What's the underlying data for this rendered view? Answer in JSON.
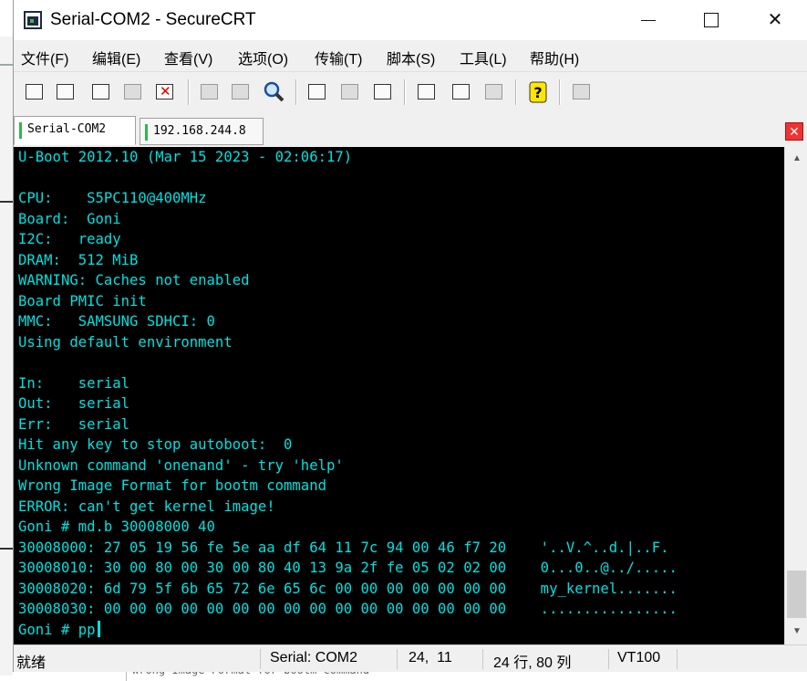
{
  "window": {
    "title": "Serial-COM2 - SecureCRT"
  },
  "menu": [
    "文件(F)",
    "编辑(E)",
    "查看(V)",
    "选项(O)",
    "传输(T)",
    "脚本(S)",
    "工具(L)",
    "帮助(H)"
  ],
  "toolbar": [
    {
      "icon": "connect-icon"
    },
    {
      "icon": "quick-connect-icon"
    },
    {
      "icon": "connect-in-tab-icon"
    },
    {
      "icon": "reconnect-icon"
    },
    {
      "icon": "disconnect-icon"
    },
    {
      "icon": "copy-icon"
    },
    {
      "icon": "paste-icon"
    },
    {
      "icon": "find-icon"
    },
    {
      "icon": "print-screen-icon"
    },
    {
      "icon": "print-selection-icon"
    },
    {
      "icon": "print-icon"
    },
    {
      "icon": "session-options-icon"
    },
    {
      "icon": "global-options-icon"
    },
    {
      "icon": "keymap-icon"
    },
    {
      "icon": "help-icon"
    },
    {
      "icon": "sftp-icon"
    }
  ],
  "tabs": [
    {
      "label": "Serial-COM2",
      "active": true
    },
    {
      "label": "192.168.244.8",
      "active": false
    }
  ],
  "terminal": {
    "lines": [
      "U-Boot 2012.10 (Mar 15 2023 - 02:06:17)",
      "",
      "CPU:    S5PC110@400MHz",
      "Board:  Goni",
      "I2C:   ready",
      "DRAM:  512 MiB",
      "WARNING: Caches not enabled",
      "Board PMIC init",
      "MMC:   SAMSUNG SDHCI: 0",
      "Using default environment",
      "",
      "In:    serial",
      "Out:   serial",
      "Err:   serial",
      "Hit any key to stop autoboot:  0",
      "Unknown command 'onenand' - try 'help'",
      "Wrong Image Format for bootm command",
      "ERROR: can't get kernel image!",
      "Goni # md.b 30008000 40",
      "30008000: 27 05 19 56 fe 5e aa df 64 11 7c 94 00 46 f7 20    '..V.^..d.|..F. ",
      "30008010: 30 00 80 00 30 00 80 40 13 9a 2f fe 05 02 02 00    0...0..@../.....",
      "30008020: 6d 79 5f 6b 65 72 6e 65 6c 00 00 00 00 00 00 00    my_kernel.......",
      "30008030: 00 00 00 00 00 00 00 00 00 00 00 00 00 00 00 00    ................",
      "Goni # pp"
    ]
  },
  "status": {
    "ready": "就绪",
    "connection": "Serial: COM2",
    "cursor_pos": "24,  11",
    "size": "24 行, 80 列",
    "emulation": "VT100"
  },
  "background_text": "Wrong Image Format for bootm command"
}
